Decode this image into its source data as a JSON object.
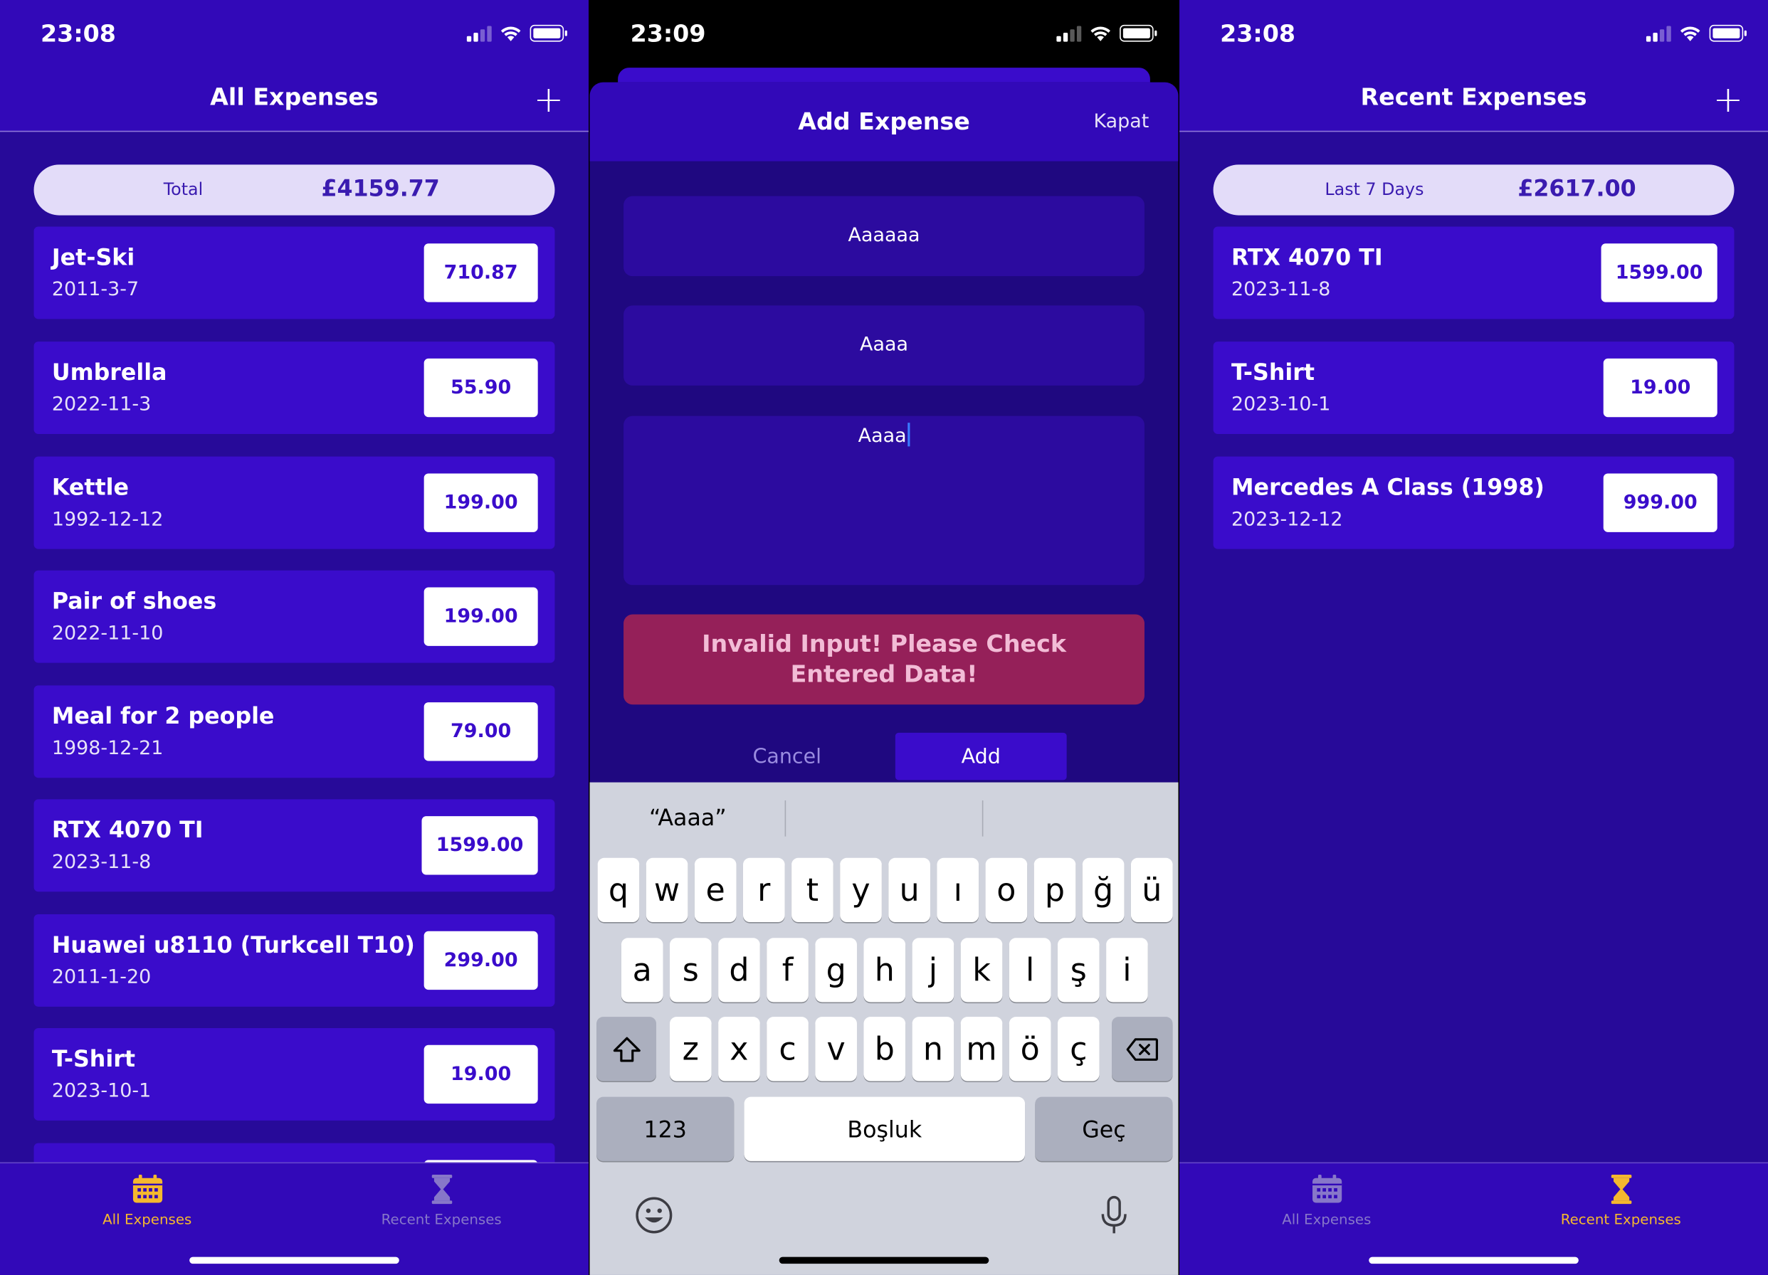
{
  "screen_all": {
    "time": "23:08",
    "title": "All Expenses",
    "add_icon": "+",
    "summary_label": "Total",
    "summary_value": "£4159.77",
    "items": [
      {
        "name": "Jet-Ski",
        "date": "2011-3-7",
        "amount": "710.87"
      },
      {
        "name": "Umbrella",
        "date": "2022-11-3",
        "amount": "55.90"
      },
      {
        "name": "Kettle",
        "date": "1992-12-12",
        "amount": "199.00"
      },
      {
        "name": "Pair of shoes",
        "date": "2022-11-10",
        "amount": "199.00"
      },
      {
        "name": "Meal for 2 people",
        "date": "1998-12-21",
        "amount": "79.00"
      },
      {
        "name": "RTX 4070 TI",
        "date": "2023-11-8",
        "amount": "1599.00"
      },
      {
        "name": "Huawei u8110 (Turkcell T10)",
        "date": "2011-1-20",
        "amount": "299.00"
      },
      {
        "name": "T-Shirt",
        "date": "2023-10-1",
        "amount": "19.00"
      }
    ]
  },
  "screen_modal": {
    "time": "23:09",
    "title": "Add Expense",
    "close_label": "Kapat",
    "field_1": "Aaaaaa",
    "field_2": "Aaaa",
    "field_3": "Aaaa",
    "error": "Invalid Input! Please Check Entered Data!",
    "cancel_label": "Cancel",
    "add_label": "Add",
    "suggestion": "“Aaaa”",
    "keyboard": {
      "row1": [
        "q",
        "w",
        "e",
        "r",
        "t",
        "y",
        "u",
        "ı",
        "o",
        "p",
        "ğ",
        "ü"
      ],
      "row2": [
        "a",
        "s",
        "d",
        "f",
        "g",
        "h",
        "j",
        "k",
        "l",
        "ş",
        "i"
      ],
      "row3": [
        "z",
        "x",
        "c",
        "v",
        "b",
        "n",
        "m",
        "ö",
        "ç"
      ],
      "numbers_label": "123",
      "space_label": "Boşluk",
      "return_label": "Geç",
      "shift_icon": "shift-icon",
      "delete_icon": "delete-icon",
      "emoji_icon": "emoji-icon",
      "mic_icon": "microphone-icon"
    }
  },
  "screen_recent": {
    "time": "23:08",
    "title": "Recent Expenses",
    "add_icon": "+",
    "summary_label": "Last 7 Days",
    "summary_value": "£2617.00",
    "items": [
      {
        "name": "RTX 4070 TI",
        "date": "2023-11-8",
        "amount": "1599.00"
      },
      {
        "name": "T-Shirt",
        "date": "2023-10-1",
        "amount": "19.00"
      },
      {
        "name": "Mercedes A Class (1998)",
        "date": "2023-12-12",
        "amount": "999.00"
      }
    ]
  },
  "tabs": {
    "all_label": "All Expenses",
    "recent_label": "Recent Expenses",
    "all_icon": "calendar-icon",
    "recent_icon": "hourglass-icon"
  },
  "colors": {
    "background": "#270a99",
    "bar": "#3209b8",
    "row": "#3a0ccb",
    "active_tab": "#f5b82e",
    "error": "#952059"
  }
}
